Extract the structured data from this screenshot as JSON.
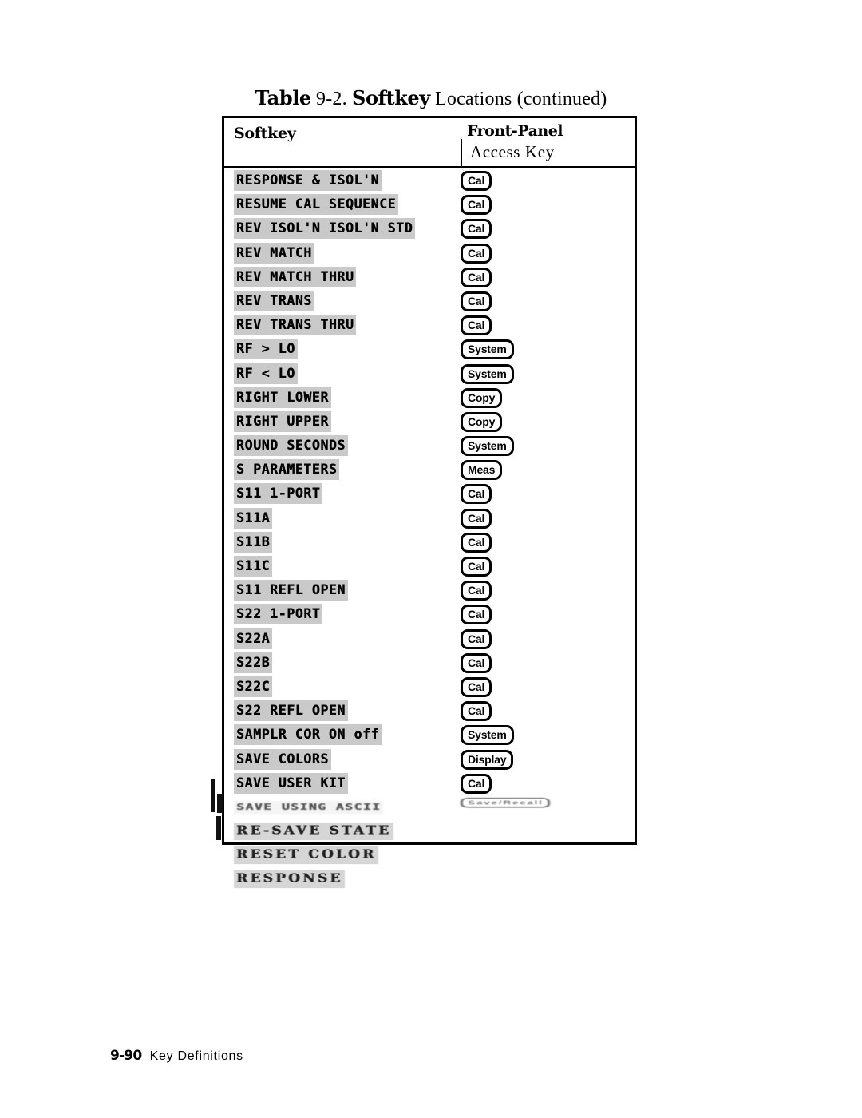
{
  "caption": {
    "table_word": "Table",
    "number": "9-2.",
    "softkey_word": "Softkey",
    "rest": "Locations (continued)"
  },
  "table": {
    "headers": {
      "col1": "Softkey",
      "col2_line1": "Front-Panel",
      "col2_line2": "Access Key"
    },
    "rows": [
      {
        "softkey": "RESPONSE & ISOL'N",
        "key": "Cal",
        "state": "normal"
      },
      {
        "softkey": "RESUME CAL SEQUENCE",
        "key": "Cal",
        "state": "normal"
      },
      {
        "softkey": "REV ISOL'N ISOL'N STD",
        "key": "Cal",
        "state": "normal"
      },
      {
        "softkey": "REV MATCH",
        "key": "Cal",
        "state": "normal"
      },
      {
        "softkey": "REV MATCH THRU",
        "key": "Cal",
        "state": "normal"
      },
      {
        "softkey": "REV TRANS",
        "key": "Cal",
        "state": "normal"
      },
      {
        "softkey": "REV TRANS THRU",
        "key": "Cal",
        "state": "normal"
      },
      {
        "softkey": "RF > LO",
        "key": "System",
        "state": "normal"
      },
      {
        "softkey": "RF < LO",
        "key": "System",
        "state": "normal"
      },
      {
        "softkey": "RIGHT LOWER",
        "key": "Copy",
        "state": "normal"
      },
      {
        "softkey": "RIGHT UPPER",
        "key": "Copy",
        "state": "normal"
      },
      {
        "softkey": "ROUND SECONDS",
        "key": "System",
        "state": "normal"
      },
      {
        "softkey": "S PARAMETERS",
        "key": "Meas",
        "state": "normal"
      },
      {
        "softkey": "S11 1-PORT",
        "key": "Cal",
        "state": "normal"
      },
      {
        "softkey": "S11A",
        "key": "Cal",
        "state": "normal"
      },
      {
        "softkey": "S11B",
        "key": "Cal",
        "state": "normal"
      },
      {
        "softkey": "S11C",
        "key": "Cal",
        "state": "normal"
      },
      {
        "softkey": "S11 REFL OPEN",
        "key": "Cal",
        "state": "normal"
      },
      {
        "softkey": "S22 1-PORT",
        "key": "Cal",
        "state": "normal"
      },
      {
        "softkey": "S22A",
        "key": "Cal",
        "state": "normal"
      },
      {
        "softkey": "S22B",
        "key": "Cal",
        "state": "normal"
      },
      {
        "softkey": "S22C",
        "key": "Cal",
        "state": "normal"
      },
      {
        "softkey": "S22 REFL OPEN",
        "key": "Cal",
        "state": "normal"
      },
      {
        "softkey": "SAMPLR COR ON off",
        "key": "System",
        "state": "normal"
      },
      {
        "softkey": "SAVE COLORS",
        "key": "Display",
        "state": "normal"
      },
      {
        "softkey": "SAVE USER KIT",
        "key": "Cal",
        "state": "normal"
      },
      {
        "softkey": "SAVE USING ASCII",
        "key": "Save/Recall",
        "state": "ghost"
      },
      {
        "softkey": "RE-SAVE STATE",
        "key": "",
        "state": "faded"
      },
      {
        "softkey": "RESET COLOR",
        "key": "",
        "state": "faded"
      },
      {
        "softkey": "RESPONSE",
        "key": "",
        "state": "faded"
      }
    ]
  },
  "footer": {
    "page": "9-90",
    "label": "Key Definitions"
  }
}
